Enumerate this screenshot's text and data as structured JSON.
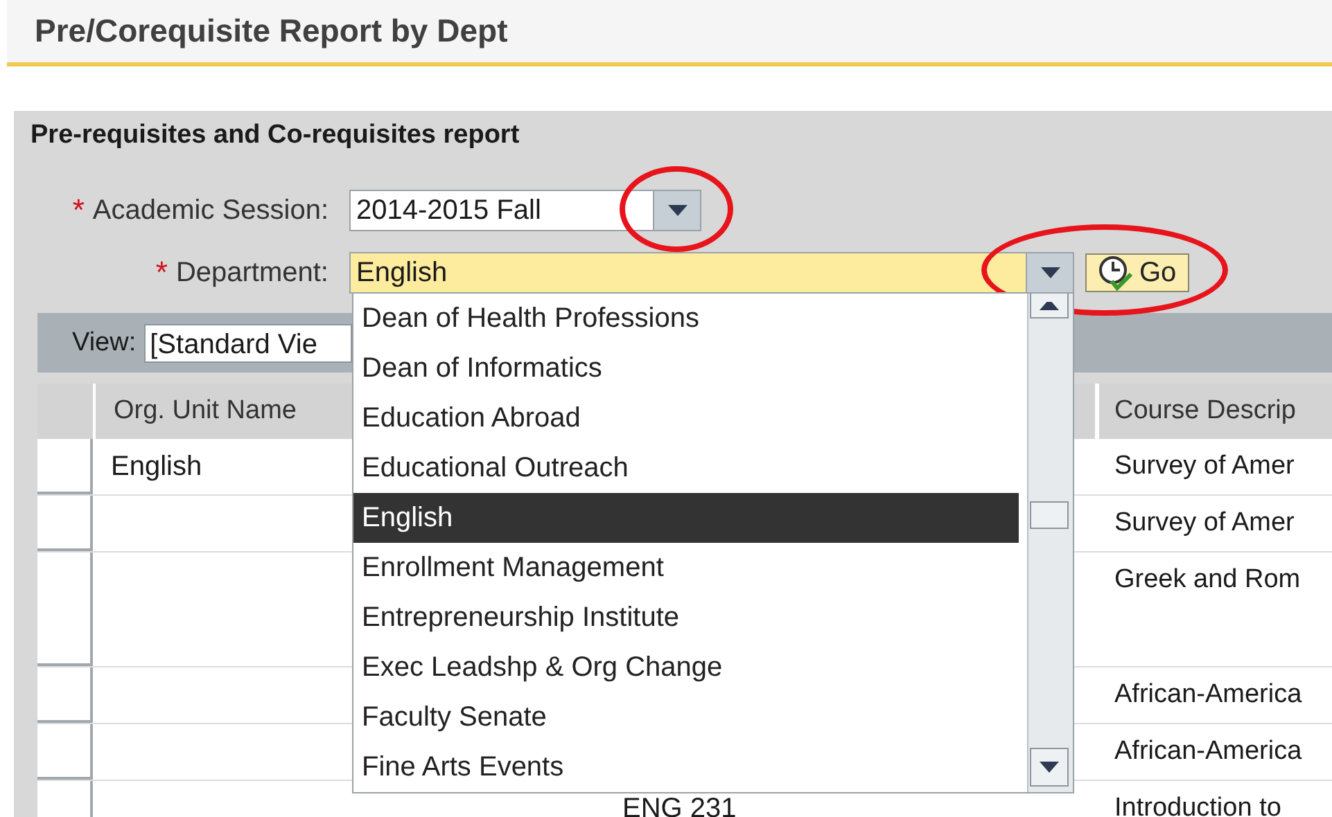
{
  "page_title": "Pre/Corequisite Report by Dept",
  "panel": {
    "title": "Pre-requisites and Co-requisites report",
    "fields": [
      {
        "label": "Academic Session:",
        "required_mark": "*",
        "value": "2014-2015 Fall",
        "highlighted": false,
        "circled": true
      },
      {
        "label": "Department:",
        "required_mark": "*",
        "value": "English",
        "highlighted": true,
        "circled": true
      }
    ],
    "go_button": {
      "label": "Go"
    }
  },
  "dropdown_list": {
    "items": [
      {
        "label": "Dean of Health Professions",
        "selected": false
      },
      {
        "label": "Dean of Informatics",
        "selected": false
      },
      {
        "label": "Education Abroad",
        "selected": false
      },
      {
        "label": "Educational Outreach",
        "selected": false
      },
      {
        "label": "English",
        "selected": true
      },
      {
        "label": "Enrollment Management",
        "selected": false
      },
      {
        "label": "Entrepreneurship Institute",
        "selected": false
      },
      {
        "label": "Exec Leadshp & Org Change",
        "selected": false
      },
      {
        "label": "Faculty Senate",
        "selected": false
      },
      {
        "label": "Fine Arts Events",
        "selected": false
      }
    ]
  },
  "view_bar": {
    "label": "View:",
    "value": "[Standard Vie"
  },
  "table": {
    "columns": {
      "org_unit_name": "Org. Unit Name",
      "course_description": "Course Descrip"
    },
    "rows": [
      {
        "org_unit_name": "English",
        "course_description": "Survey of Amer"
      },
      {
        "course_description": "Survey of Amer"
      },
      {
        "course_description": "Greek and Rom"
      },
      {
        "course_description": "African-America"
      },
      {
        "course_description": "African-America"
      },
      {
        "column_4": "ENG 231",
        "course_description": "Introduction to"
      }
    ]
  }
}
